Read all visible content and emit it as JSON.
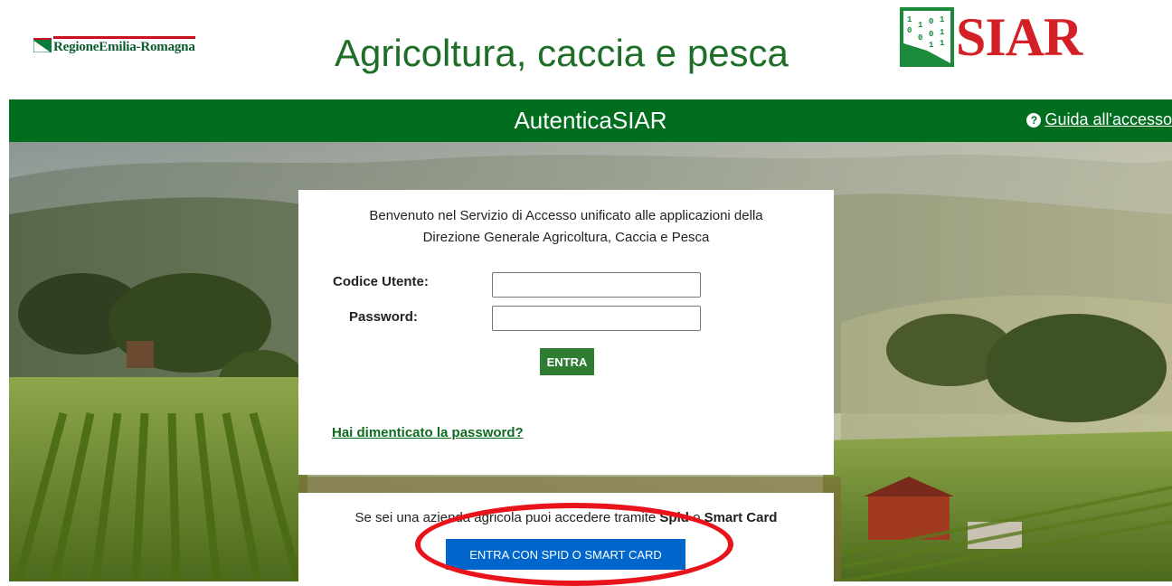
{
  "header": {
    "brand_name": "RegioneEmilia-Romagna",
    "site_title": "Agricoltura, caccia e pesca",
    "logo_text": "SIAR",
    "logo_digits": [
      "1",
      "0",
      "1",
      "0",
      "1",
      "0",
      "1",
      "1",
      "0",
      "1"
    ]
  },
  "bar": {
    "title": "AutenticaSIAR",
    "help_icon": "question-circle-icon",
    "help_label": " Guida all'accesso"
  },
  "login": {
    "welcome_line1": "Benvenuto nel Servizio di Accesso unificato alle applicazioni della",
    "welcome_line2": "Direzione Generale Agricoltura, Caccia e Pesca",
    "user_label": "Codice Utente:",
    "user_value": "",
    "password_label": "Password:",
    "password_value": "",
    "submit_label": "ENTRA",
    "forgot_label": "Hai dimenticato la password?"
  },
  "spid": {
    "text_before": "Se sei una azienda agricola puoi accedere tramite ",
    "spid_word": "Spid",
    "text_mid": " o ",
    "smartcard_word": "Smart Card",
    "button_label": "ENTRA CON SPID O SMART CARD"
  },
  "colors": {
    "brand_green": "#006d1f",
    "title_green": "#1e6e28",
    "siar_red": "#d32027",
    "spid_blue": "#0066cc",
    "highlight_red": "#e8131b"
  }
}
